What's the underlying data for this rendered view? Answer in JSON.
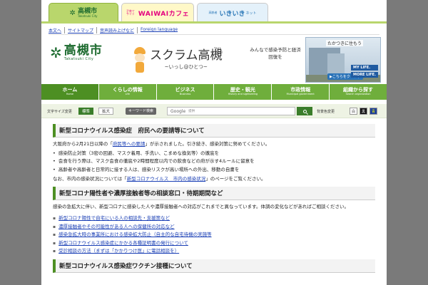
{
  "tabs": [
    {
      "logo": "高槻市",
      "sub": "Takatsuki City"
    },
    {
      "sub": "子育て サイト",
      "brand": "WAIWAIカフェ"
    },
    {
      "sub": "高齢者",
      "brand": "いきいき",
      "suffix": "ネット"
    }
  ],
  "utility_links": [
    "本文へ",
    "サイトマップ",
    "音声読み上げなど",
    "Foreign language"
  ],
  "header": {
    "logo_name": "高槻市",
    "logo_sub": "Takatsuki City",
    "banner_main_prefix": "スクラム",
    "banner_main_kanji": "高槻",
    "banner_ruby": "TAKA TSUKI",
    "banner_sub": "~いっし@ひとつ~",
    "banner_mid": "みんなで感染予防と経済回復を",
    "banner_right_title": "たかつきに住もう",
    "banner_right_click": "▶こちらをクリック",
    "banner_right_my1": "MY LIFE.",
    "banner_right_my2": "MORE LIFE."
  },
  "nav": [
    {
      "jp": "ホーム",
      "en": "Home"
    },
    {
      "jp": "くらしの情報",
      "en": "Life"
    },
    {
      "jp": "ビジネス",
      "en": "Business"
    },
    {
      "jp": "歴史・観光",
      "en": "History and sightseeing"
    },
    {
      "jp": "市政情報",
      "en": "Municipal government"
    },
    {
      "jp": "組織から探す",
      "en": "Search organization"
    }
  ],
  "tools": {
    "font_size_label": "文字サイズ変更",
    "font_std": "標準",
    "font_big": "拡大",
    "keyword_label": "キーワード検索",
    "search_brand": "Google",
    "search_placeholder": "提供",
    "bg_label": "背景色変更",
    "bg_white": "白",
    "bg_black": "黒",
    "bg_blue": "青"
  },
  "content": {
    "section1_title": "新型コロナウイルス感染症　府民への要請等について",
    "s1_p1_a": "大阪府から2月21日以降の「",
    "s1_p1_link": "府民等への要請",
    "s1_p1_b": "」が示されました。引き続き、感染対策に努めてください。",
    "s1_bullets": [
      "感染防止対策（3密の回避、マスク着用、手洗い、こまめな換気等）の徹底を",
      "会食を行う際は、マスク会食の徹底や2時間程度以内での飲食などの府が示す4ルールに留意を",
      "高齢者や高齢者と日常的に接する人は、感染リスクが高い場所への外出、移動の自粛を"
    ],
    "s1_p2_a": "なお、市内の感染状況については「",
    "s1_p2_link": "新型コロナウイルス　市内の感染状況",
    "s1_p2_b": "」のページをご覧ください。",
    "section2_title": "新型コロナ陽性者や濃厚接触者等の相談窓口・待期期間など",
    "s2_p1": "感染の急拡大に伴い、新型コロナに感染した人や濃厚接触者への対応がこれまでと異なっています。体調の変化などがあればご相談ください。",
    "s2_links": [
      "新型コロナ陽性で自宅にいる人の相談先・支援策など",
      "濃厚接触者やその可能性がある人への保健所の対応など",
      "感染急拡大時の事業所における感染拡大防止（自主的な自宅待機の実施等",
      "新型コロナウイルス感染症にかかる各種証明書の発行について",
      "受診相談の方法（まずは「かかりつけ医」に電話相談を）"
    ],
    "section3_title": "新型コロナウイルス感染症ワクチン接種について"
  }
}
